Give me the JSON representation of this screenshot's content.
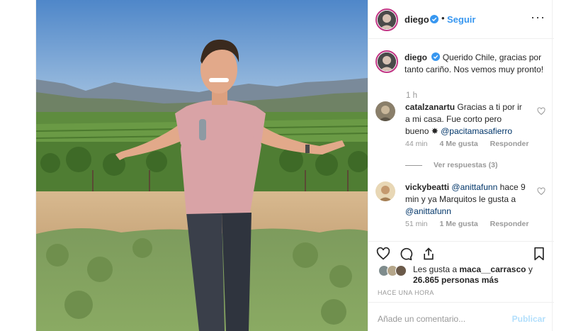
{
  "post": {
    "username": "diego",
    "follow_label": "Seguir",
    "dot": "•",
    "more": "···",
    "caption": {
      "username": "diego",
      "text": "Querido Chile, gracias por tanto cariño. Nos vemos muy pronto!",
      "time": "1 h"
    },
    "comments": [
      {
        "username": "catalzanartu",
        "text_before": "Gracias a ti por ir a mi casa. Fue corto pero bueno",
        "emoji": "✸",
        "mention": "@pacitamasafierro",
        "time": "44 min",
        "likes": "4 Me gusta",
        "reply": "Responder",
        "view_replies": "Ver respuestas (3)"
      },
      {
        "username": "vickybeatti",
        "mention": "@anittafunn",
        "text_middle": "hace 9 min y ya Marquitos le gusta a",
        "mention2": "@anittafunn",
        "time": "51 min",
        "likes": "1 Me gusta",
        "reply": "Responder"
      }
    ],
    "liked_by": {
      "prefix": "Les gusta a",
      "user": "maca__carrasco",
      "and": "y",
      "count": "26.865 personas más"
    },
    "posted_ago": "HACE UNA HORA",
    "add_comment_placeholder": "Añade un comentario...",
    "publish_label": "Publicar"
  },
  "colors": {
    "link": "#3897f0",
    "mention": "#003569",
    "meta": "#999999",
    "publish_disabled": "#b2dffc",
    "story_ring": "#c13584"
  },
  "icons": [
    "verified-badge-icon",
    "more-options-icon",
    "heart-icon",
    "comment-icon",
    "share-icon",
    "bookmark-icon"
  ]
}
